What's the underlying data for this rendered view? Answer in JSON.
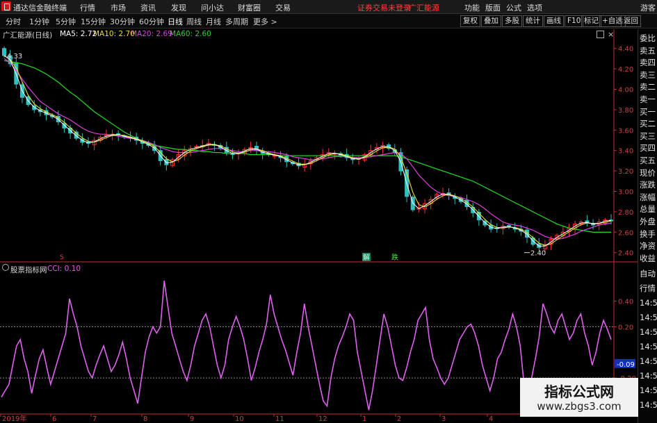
{
  "menu": {
    "app_title": "通达信金融终端",
    "items": [
      "行情",
      "市场",
      "资讯",
      "发现",
      "问小达",
      "财富圈",
      "交易"
    ],
    "status": "证券交易未登录",
    "stock_tag": "广汇能源",
    "right_items": [
      "功能",
      "版面",
      "公式",
      "选项"
    ],
    "user": "游客"
  },
  "periods": [
    "分时",
    "1分钟",
    "5分钟",
    "15分钟",
    "30分钟",
    "60分钟",
    "日线",
    "周线",
    "月线",
    "多周期",
    "更多 >"
  ],
  "toolbar_right": [
    "复权",
    "叠加",
    "多股",
    "统计",
    "画线",
    "F10",
    "标记",
    "+自选",
    "返回"
  ],
  "price_legend": {
    "name": "广汇能源(日线)",
    "ma5": "MA5: 2.72",
    "ma10": "MA10: 2.70",
    "ma20": "MA20: 2.69",
    "ma60": "MA60: 2.60"
  },
  "cci_legend": {
    "name": "股票指标网",
    "value": "CCI: 0.10"
  },
  "sidebar": [
    "委比",
    "卖五",
    "卖四",
    "卖三",
    "卖二",
    "卖一",
    "买一",
    "买二",
    "买三",
    "买四",
    "买五",
    "现价",
    "涨跌",
    "涨幅",
    "总量",
    "外盘",
    "换手",
    "净资",
    "收益",
    "自动",
    "行情",
    "14:5",
    "14:5",
    "14:5",
    "14:5",
    "14:5",
    "14:5",
    "14:5",
    "14:5"
  ],
  "markers": {
    "buy": "解",
    "sell": "跌",
    "s": "S"
  },
  "watermark": {
    "title": "指标公式网",
    "url": "www.zbgs3.com"
  },
  "colors": {
    "ma5": "#ffffff",
    "ma10": "#e8e030",
    "ma20": "#e040e0",
    "ma60": "#20d020",
    "up": "#ff3030",
    "down": "#30c0c0",
    "cci": "#e060f0",
    "axis": "#c03030"
  },
  "chart_data": [
    {
      "type": "candlestick",
      "title": "广汇能源(日线)",
      "series_names": [
        "MA5",
        "MA10",
        "MA20",
        "MA60"
      ],
      "ylim": [
        2.33,
        4.5
      ],
      "y_ticks": [
        4.4,
        4.2,
        4.0,
        3.8,
        3.6,
        3.4,
        3.2,
        3.0,
        2.8,
        2.6,
        2.4
      ],
      "y_tick_labels": [
        "4.40",
        "4.20",
        "4.00",
        "3.80",
        "3.60",
        "3.40",
        "3.20",
        "3.00",
        "2.80",
        "2.60",
        "2.40"
      ],
      "annotations": [
        {
          "text": "4.33",
          "value": 4.33
        },
        {
          "text": "2.40",
          "value": 2.4
        }
      ],
      "x_labels": [
        "2019年",
        "6",
        "7",
        "8",
        "9",
        "10",
        "11",
        "12",
        "1",
        "2",
        "3",
        "4"
      ],
      "close": [
        4.33,
        4.25,
        4.05,
        3.92,
        3.85,
        3.8,
        3.78,
        3.75,
        3.73,
        3.68,
        3.62,
        3.57,
        3.52,
        3.48,
        3.47,
        3.5,
        3.53,
        3.55,
        3.56,
        3.55,
        3.53,
        3.52,
        3.5,
        3.47,
        3.45,
        3.4,
        3.3,
        3.26,
        3.31,
        3.36,
        3.4,
        3.42,
        3.44,
        3.45,
        3.47,
        3.45,
        3.42,
        3.38,
        3.36,
        3.38,
        3.41,
        3.43,
        3.4,
        3.37,
        3.36,
        3.35,
        3.33,
        3.29,
        3.27,
        3.25,
        3.27,
        3.3,
        3.33,
        3.36,
        3.38,
        3.37,
        3.35,
        3.33,
        3.31,
        3.32,
        3.36,
        3.4,
        3.43,
        3.45,
        3.42,
        3.38,
        3.2,
        2.95,
        2.82,
        2.84,
        2.88,
        2.92,
        2.97,
        2.98,
        2.96,
        2.93,
        2.9,
        2.85,
        2.79,
        2.72,
        2.67,
        2.63,
        2.64,
        2.66,
        2.65,
        2.63,
        2.61,
        2.55,
        2.48,
        2.45,
        2.48,
        2.53,
        2.57,
        2.6,
        2.64,
        2.68,
        2.7,
        2.69,
        2.67,
        2.7,
        2.72,
        2.71
      ],
      "ma20": [
        4.3,
        4.26,
        4.18,
        4.1,
        4.02,
        3.95,
        3.88,
        3.84,
        3.8,
        3.76,
        3.73,
        3.7,
        3.66,
        3.62,
        3.59,
        3.57,
        3.56,
        3.56,
        3.55,
        3.54,
        3.53,
        3.52,
        3.51,
        3.5,
        3.48,
        3.46,
        3.43,
        3.41,
        3.39,
        3.38,
        3.38,
        3.38,
        3.39,
        3.4,
        3.41,
        3.42,
        3.42,
        3.41,
        3.4,
        3.39,
        3.39,
        3.4,
        3.4,
        3.39,
        3.39,
        3.38,
        3.37,
        3.36,
        3.34,
        3.33,
        3.32,
        3.31,
        3.31,
        3.32,
        3.33,
        3.34,
        3.34,
        3.34,
        3.33,
        3.33,
        3.33,
        3.34,
        3.35,
        3.36,
        3.37,
        3.38,
        3.37,
        3.32,
        3.24,
        3.16,
        3.1,
        3.04,
        3.0,
        2.97,
        2.96,
        2.95,
        2.94,
        2.92,
        2.9,
        2.87,
        2.83,
        2.78,
        2.74,
        2.7,
        2.68,
        2.67,
        2.66,
        2.64,
        2.62,
        2.59,
        2.56,
        2.54,
        2.53,
        2.54,
        2.56,
        2.58,
        2.61,
        2.63,
        2.65,
        2.67,
        2.68,
        2.69
      ],
      "ma60": [
        4.28,
        4.27,
        4.26,
        4.25,
        4.23,
        4.21,
        4.18,
        4.15,
        4.11,
        4.07,
        4.02,
        3.97,
        3.93,
        3.88,
        3.83,
        3.78,
        3.74,
        3.7,
        3.66,
        3.62,
        3.58,
        3.55,
        3.52,
        3.49,
        3.47,
        3.45,
        3.44,
        3.43,
        3.42,
        3.41,
        3.41,
        3.4,
        3.4,
        3.39,
        3.39,
        3.38,
        3.38,
        3.37,
        3.37,
        3.37,
        3.37,
        3.36,
        3.36,
        3.36,
        3.36,
        3.36,
        3.35,
        3.35,
        3.35,
        3.35,
        3.35,
        3.35,
        3.35,
        3.35,
        3.35,
        3.35,
        3.35,
        3.35,
        3.35,
        3.35,
        3.35,
        3.35,
        3.35,
        3.35,
        3.35,
        3.35,
        3.34,
        3.32,
        3.3,
        3.28,
        3.26,
        3.24,
        3.22,
        3.2,
        3.18,
        3.16,
        3.14,
        3.12,
        3.1,
        3.07,
        3.04,
        3.01,
        2.98,
        2.95,
        2.92,
        2.89,
        2.86,
        2.83,
        2.8,
        2.77,
        2.74,
        2.71,
        2.68,
        2.66,
        2.64,
        2.63,
        2.62,
        2.61,
        2.6,
        2.6,
        2.6,
        2.6
      ]
    },
    {
      "type": "line",
      "title": "股票指标网",
      "series_names": [
        "CCI"
      ],
      "ylim": [
        -0.46,
        0.62
      ],
      "y_ticks": [
        0.4,
        0.2,
        -0.09,
        -0.2,
        -0.4
      ],
      "y_tick_labels": [
        "0.40",
        "0.20",
        "-0.09",
        "-0.20",
        "-0.40"
      ],
      "current": "-0.09",
      "cci": [
        -0.35,
        -0.3,
        -0.25,
        -0.1,
        0.05,
        0.1,
        -0.05,
        -0.15,
        -0.32,
        -0.18,
        -0.05,
        0.02,
        -0.12,
        -0.25,
        -0.15,
        -0.05,
        0.05,
        0.15,
        0.42,
        0.3,
        0.2,
        0.05,
        -0.05,
        -0.15,
        -0.2,
        -0.1,
        -0.02,
        0.05,
        -0.05,
        -0.15,
        -0.1,
        -0.02,
        0.08,
        -0.05,
        -0.2,
        -0.3,
        -0.4,
        -0.2,
        0.0,
        0.12,
        0.2,
        0.15,
        0.2,
        0.56,
        0.35,
        0.15,
        0.05,
        -0.05,
        -0.15,
        -0.22,
        -0.1,
        0.05,
        0.15,
        0.25,
        0.3,
        0.2,
        0.05,
        -0.1,
        -0.2,
        -0.1,
        0.1,
        0.2,
        0.28,
        0.2,
        0.1,
        -0.05,
        -0.22,
        -0.12,
        0.0,
        0.1,
        0.22,
        0.45,
        0.3,
        0.2,
        0.1,
        0.02,
        -0.08,
        -0.18,
        0.0,
        0.15,
        0.38,
        0.2,
        0.05,
        -0.1,
        -0.25,
        -0.38,
        -0.42,
        -0.2,
        -0.05,
        0.05,
        0.12,
        0.2,
        0.3,
        0.25,
        0.0,
        -0.15,
        -0.3,
        -0.45,
        -0.3,
        -0.1,
        0.1,
        0.3,
        0.2,
        0.05,
        -0.1,
        -0.2,
        -0.22,
        -0.12,
        0.0,
        0.1,
        0.25,
        0.3,
        0.35,
        0.1,
        -0.05,
        -0.12,
        -0.2,
        -0.25,
        -0.2,
        -0.1,
        0.0,
        0.1,
        0.15,
        0.2,
        0.22,
        0.15,
        0.05,
        -0.1,
        -0.2,
        -0.3,
        -0.2,
        -0.05,
        0.0,
        0.1,
        0.18,
        0.3,
        0.2,
        0.05,
        -0.25,
        -0.3,
        -0.2,
        -0.05,
        0.12,
        0.38,
        0.3,
        0.2,
        0.15,
        0.25,
        0.3,
        0.2,
        0.1,
        0.15,
        0.25,
        0.3,
        0.15,
        0.05,
        -0.1,
        0.0,
        0.15,
        0.25,
        0.18,
        0.1
      ]
    }
  ]
}
